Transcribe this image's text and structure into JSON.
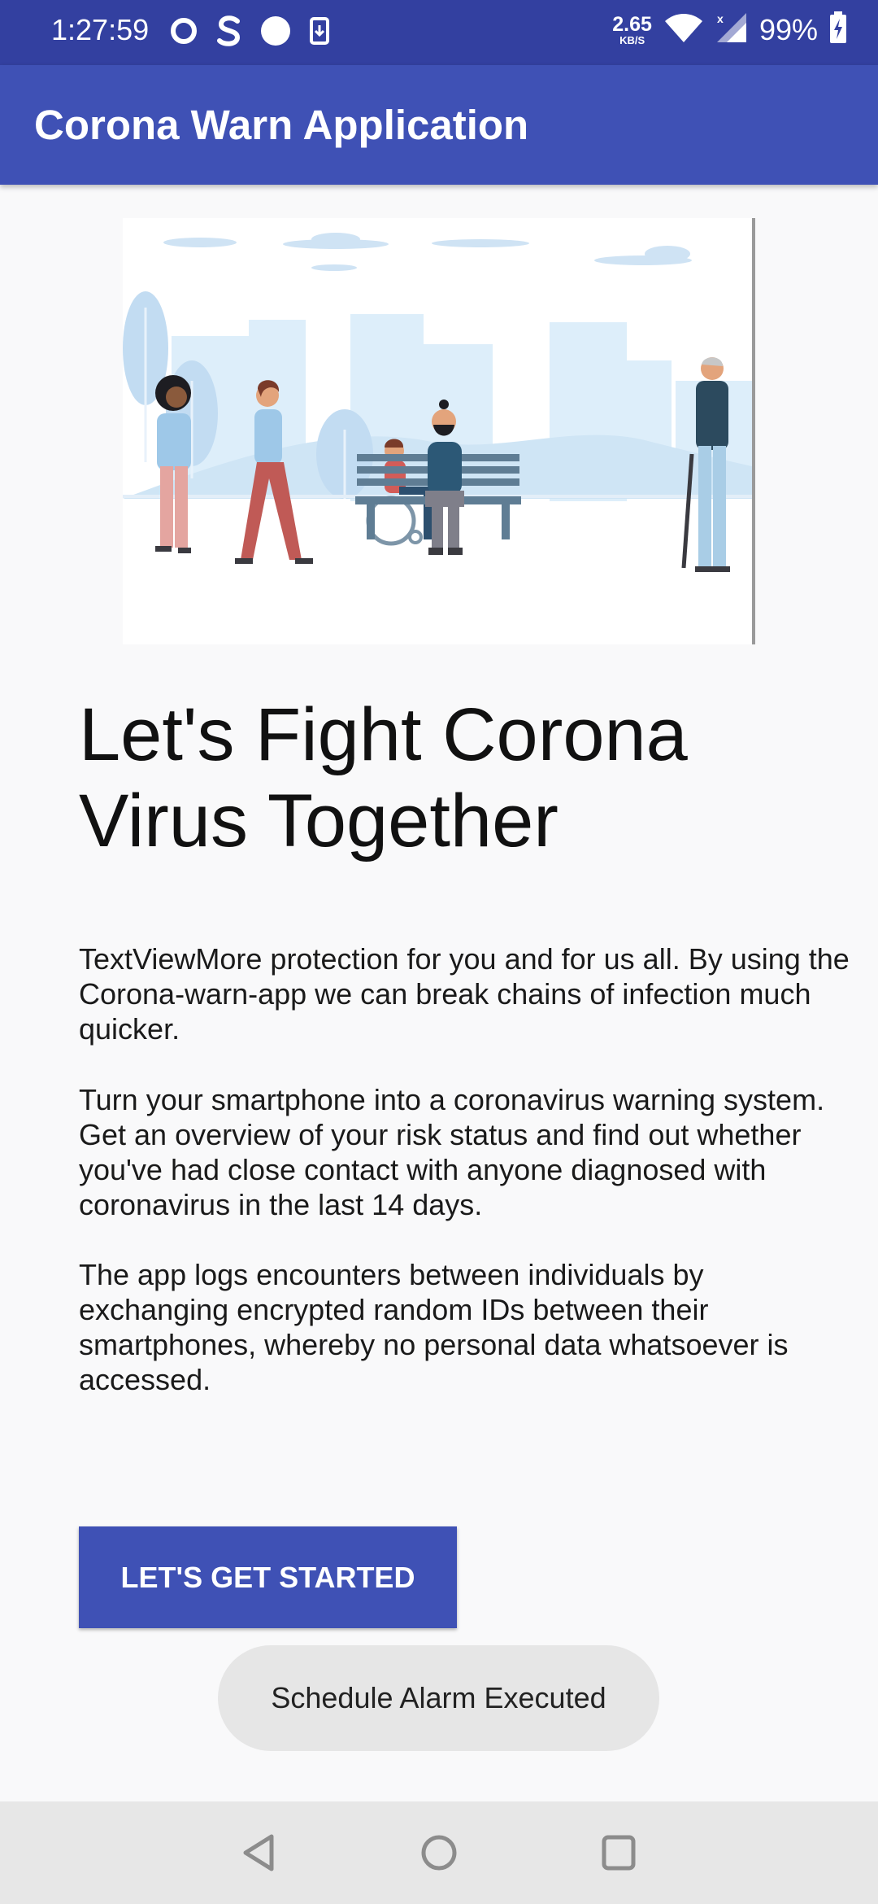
{
  "status_bar": {
    "time": "1:27:59",
    "net_speed_value": "2.65",
    "net_speed_unit": "KB/S",
    "battery": "99%",
    "icons": [
      "sync-circle-icon",
      "s-app-icon",
      "dot-icon",
      "download-icon",
      "wifi-icon",
      "cellular-signal-icon",
      "battery-charging-icon"
    ]
  },
  "app_bar": {
    "title": "Corona Warn Application",
    "color": "#3f51b5"
  },
  "hero": {
    "image": "people-walking-in-park-illustration"
  },
  "main": {
    "headline": "Let's Fight Corona Virus Together",
    "paragraphs": [
      "TextViewMore protection for you and for us all. By using the Corona-warn-app we can break chains of infection much quicker.",
      "Turn your smartphone into a coronavirus warning system. Get an overview of your risk status and find out whether you've had close contact with anyone diagnosed with coronavirus in the last 14 days.",
      "The app logs encounters between individuals by exchanging encrypted random IDs between their smartphones, whereby no personal data whatsoever is accessed."
    ],
    "start_button_label": "LET'S GET STARTED"
  },
  "toast": {
    "message": "Schedule Alarm Executed"
  },
  "nav_bar": {
    "buttons": [
      "back-icon",
      "home-icon",
      "recents-icon"
    ]
  }
}
